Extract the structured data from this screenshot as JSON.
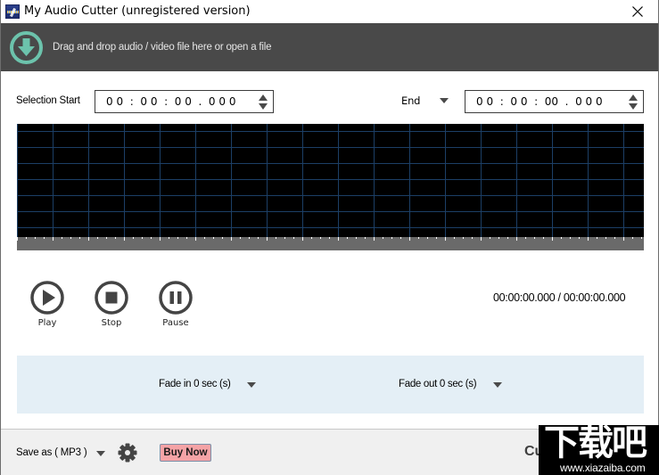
{
  "window": {
    "title": "My Audio Cutter (unregistered version)",
    "close_label": "Close"
  },
  "drop_bar": {
    "icon": "download-circle-icon",
    "text": "Drag and drop audio / video file here or open a file"
  },
  "selection": {
    "start_label": "Selection Start",
    "start_value": "0 0  :  0 0  :  0 0  .  0 0 0",
    "end_label": "End",
    "end_value": "0 0  :  0 0  :  00  .  0 0 0"
  },
  "colors": {
    "drop_bar_bg": "#494949",
    "accent_teal": "#6cc3ac",
    "waveform_bg": "#000000",
    "grid_line": "#1c3f66",
    "ruler_bg": "#6a6a6a",
    "fade_panel_bg": "#e4eff6",
    "buy_now_bg": "#f5a3a6"
  },
  "transport": {
    "play_label": "Play",
    "stop_label": "Stop",
    "pause_label": "Pause",
    "time_readout": "00:00:00.000 / 00:00:00.000"
  },
  "fade": {
    "fade_in_label": "Fade in 0 sec (s)",
    "fade_out_label": "Fade out 0 sec (s)"
  },
  "bottom": {
    "save_as_label": "Save as ( MP3 )",
    "buy_now_label": "Buy Now",
    "cut_label": "Cut"
  },
  "watermark": {
    "big_text": "下载吧",
    "url": "www.xiazaiba.com"
  }
}
